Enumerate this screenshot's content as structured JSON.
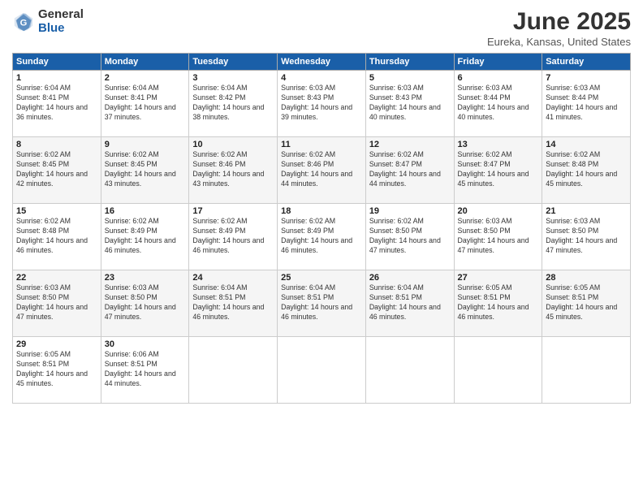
{
  "header": {
    "logo_general": "General",
    "logo_blue": "Blue",
    "month_title": "June 2025",
    "location": "Eureka, Kansas, United States"
  },
  "weekdays": [
    "Sunday",
    "Monday",
    "Tuesday",
    "Wednesday",
    "Thursday",
    "Friday",
    "Saturday"
  ],
  "weeks": [
    [
      {
        "day": "1",
        "sunrise": "Sunrise: 6:04 AM",
        "sunset": "Sunset: 8:41 PM",
        "daylight": "Daylight: 14 hours and 36 minutes."
      },
      {
        "day": "2",
        "sunrise": "Sunrise: 6:04 AM",
        "sunset": "Sunset: 8:41 PM",
        "daylight": "Daylight: 14 hours and 37 minutes."
      },
      {
        "day": "3",
        "sunrise": "Sunrise: 6:04 AM",
        "sunset": "Sunset: 8:42 PM",
        "daylight": "Daylight: 14 hours and 38 minutes."
      },
      {
        "day": "4",
        "sunrise": "Sunrise: 6:03 AM",
        "sunset": "Sunset: 8:43 PM",
        "daylight": "Daylight: 14 hours and 39 minutes."
      },
      {
        "day": "5",
        "sunrise": "Sunrise: 6:03 AM",
        "sunset": "Sunset: 8:43 PM",
        "daylight": "Daylight: 14 hours and 40 minutes."
      },
      {
        "day": "6",
        "sunrise": "Sunrise: 6:03 AM",
        "sunset": "Sunset: 8:44 PM",
        "daylight": "Daylight: 14 hours and 40 minutes."
      },
      {
        "day": "7",
        "sunrise": "Sunrise: 6:03 AM",
        "sunset": "Sunset: 8:44 PM",
        "daylight": "Daylight: 14 hours and 41 minutes."
      }
    ],
    [
      {
        "day": "8",
        "sunrise": "Sunrise: 6:02 AM",
        "sunset": "Sunset: 8:45 PM",
        "daylight": "Daylight: 14 hours and 42 minutes."
      },
      {
        "day": "9",
        "sunrise": "Sunrise: 6:02 AM",
        "sunset": "Sunset: 8:45 PM",
        "daylight": "Daylight: 14 hours and 43 minutes."
      },
      {
        "day": "10",
        "sunrise": "Sunrise: 6:02 AM",
        "sunset": "Sunset: 8:46 PM",
        "daylight": "Daylight: 14 hours and 43 minutes."
      },
      {
        "day": "11",
        "sunrise": "Sunrise: 6:02 AM",
        "sunset": "Sunset: 8:46 PM",
        "daylight": "Daylight: 14 hours and 44 minutes."
      },
      {
        "day": "12",
        "sunrise": "Sunrise: 6:02 AM",
        "sunset": "Sunset: 8:47 PM",
        "daylight": "Daylight: 14 hours and 44 minutes."
      },
      {
        "day": "13",
        "sunrise": "Sunrise: 6:02 AM",
        "sunset": "Sunset: 8:47 PM",
        "daylight": "Daylight: 14 hours and 45 minutes."
      },
      {
        "day": "14",
        "sunrise": "Sunrise: 6:02 AM",
        "sunset": "Sunset: 8:48 PM",
        "daylight": "Daylight: 14 hours and 45 minutes."
      }
    ],
    [
      {
        "day": "15",
        "sunrise": "Sunrise: 6:02 AM",
        "sunset": "Sunset: 8:48 PM",
        "daylight": "Daylight: 14 hours and 46 minutes."
      },
      {
        "day": "16",
        "sunrise": "Sunrise: 6:02 AM",
        "sunset": "Sunset: 8:49 PM",
        "daylight": "Daylight: 14 hours and 46 minutes."
      },
      {
        "day": "17",
        "sunrise": "Sunrise: 6:02 AM",
        "sunset": "Sunset: 8:49 PM",
        "daylight": "Daylight: 14 hours and 46 minutes."
      },
      {
        "day": "18",
        "sunrise": "Sunrise: 6:02 AM",
        "sunset": "Sunset: 8:49 PM",
        "daylight": "Daylight: 14 hours and 46 minutes."
      },
      {
        "day": "19",
        "sunrise": "Sunrise: 6:02 AM",
        "sunset": "Sunset: 8:50 PM",
        "daylight": "Daylight: 14 hours and 47 minutes."
      },
      {
        "day": "20",
        "sunrise": "Sunrise: 6:03 AM",
        "sunset": "Sunset: 8:50 PM",
        "daylight": "Daylight: 14 hours and 47 minutes."
      },
      {
        "day": "21",
        "sunrise": "Sunrise: 6:03 AM",
        "sunset": "Sunset: 8:50 PM",
        "daylight": "Daylight: 14 hours and 47 minutes."
      }
    ],
    [
      {
        "day": "22",
        "sunrise": "Sunrise: 6:03 AM",
        "sunset": "Sunset: 8:50 PM",
        "daylight": "Daylight: 14 hours and 47 minutes."
      },
      {
        "day": "23",
        "sunrise": "Sunrise: 6:03 AM",
        "sunset": "Sunset: 8:50 PM",
        "daylight": "Daylight: 14 hours and 47 minutes."
      },
      {
        "day": "24",
        "sunrise": "Sunrise: 6:04 AM",
        "sunset": "Sunset: 8:51 PM",
        "daylight": "Daylight: 14 hours and 46 minutes."
      },
      {
        "day": "25",
        "sunrise": "Sunrise: 6:04 AM",
        "sunset": "Sunset: 8:51 PM",
        "daylight": "Daylight: 14 hours and 46 minutes."
      },
      {
        "day": "26",
        "sunrise": "Sunrise: 6:04 AM",
        "sunset": "Sunset: 8:51 PM",
        "daylight": "Daylight: 14 hours and 46 minutes."
      },
      {
        "day": "27",
        "sunrise": "Sunrise: 6:05 AM",
        "sunset": "Sunset: 8:51 PM",
        "daylight": "Daylight: 14 hours and 46 minutes."
      },
      {
        "day": "28",
        "sunrise": "Sunrise: 6:05 AM",
        "sunset": "Sunset: 8:51 PM",
        "daylight": "Daylight: 14 hours and 45 minutes."
      }
    ],
    [
      {
        "day": "29",
        "sunrise": "Sunrise: 6:05 AM",
        "sunset": "Sunset: 8:51 PM",
        "daylight": "Daylight: 14 hours and 45 minutes."
      },
      {
        "day": "30",
        "sunrise": "Sunrise: 6:06 AM",
        "sunset": "Sunset: 8:51 PM",
        "daylight": "Daylight: 14 hours and 44 minutes."
      },
      null,
      null,
      null,
      null,
      null
    ]
  ]
}
